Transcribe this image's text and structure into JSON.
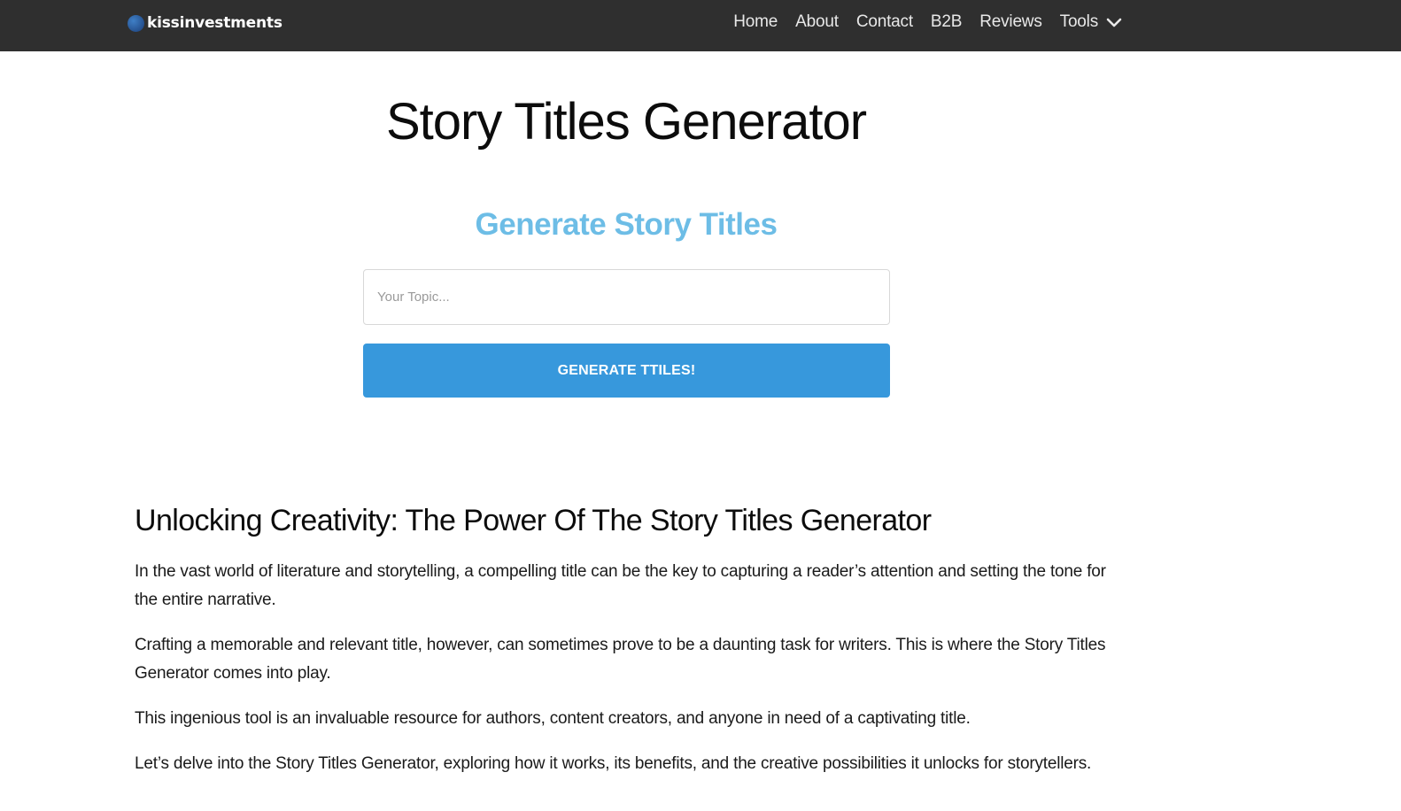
{
  "header": {
    "brand": "kissinvestments",
    "nav": [
      "Home",
      "About",
      "Contact",
      "B2B",
      "Reviews",
      "Tools"
    ]
  },
  "hero": {
    "title": "Story Titles Generator"
  },
  "generator": {
    "heading": "Generate Story Titles",
    "input_placeholder": "Your Topic...",
    "input_value": "",
    "button_label": "GENERATE TTILES!"
  },
  "article": {
    "heading": "Unlocking Creativity: The Power Of The Story Titles Generator",
    "paragraphs": [
      "In the vast world of literature and storytelling, a compelling title can be the key to capturing a reader’s attention and setting the tone for the entire narrative.",
      "Crafting a memorable and relevant title, however, can sometimes prove to be a daunting task for writers. This is where the Story Titles Generator comes into play.",
      "This ingenious tool is an invaluable resource for authors, content creators, and anyone in need of a captivating title.",
      "Let’s delve into the Story Titles Generator, exploring how it works, its benefits, and the creative possibilities it unlocks for storytellers."
    ]
  },
  "colors": {
    "topbar": "#2f2f2f",
    "subheading": "#6dbde6",
    "button": "#3798dc"
  },
  "icons": {
    "brand": "globe-logo-icon",
    "tools": "chevron-down-icon"
  }
}
